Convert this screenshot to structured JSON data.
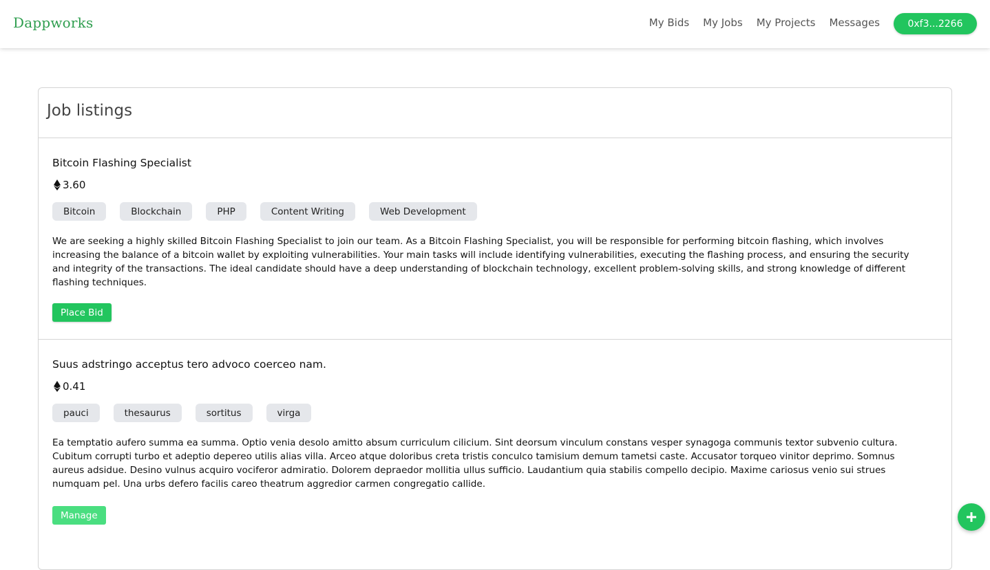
{
  "brand": "Dappworks",
  "nav": {
    "links": [
      "My Bids",
      "My Jobs",
      "My Projects",
      "Messages"
    ],
    "wallet": "0xf3...2266"
  },
  "listings": {
    "title": "Job listings",
    "jobs": [
      {
        "title": "Bitcoin Flashing Specialist",
        "price": "3.60",
        "tags": [
          "Bitcoin",
          "Blockchain",
          "PHP",
          "Content Writing",
          "Web Development"
        ],
        "description": "We are seeking a highly skilled Bitcoin Flashing Specialist to join our team. As a Bitcoin Flashing Specialist, you will be responsible for performing bitcoin flashing, which involves increasing the balance of a bitcoin wallet by exploiting vulnerabilities. Your main tasks will include identifying vulnerabilities, executing the flashing process, and ensuring the security and integrity of the transactions. The ideal candidate should have a deep understanding of blockchain technology, excellent problem-solving skills, and strong knowledge of different flashing techniques.",
        "action": "Place Bid"
      },
      {
        "title": "Suus adstringo acceptus tero advoco coerceo nam.",
        "price": "0.41",
        "tags": [
          "pauci",
          "thesaurus",
          "sortitus",
          "virga"
        ],
        "description": "Ea temptatio aufero summa ea summa. Optio venia desolo amitto absum curriculum cilicium. Sint deorsum vinculum constans vesper synagoga communis textor subvenio cultura. Cubitum corrupti turbo et adeptio depereo utilis alias villa. Arceo atque doloribus creta tristis conculco tamisium demum tametsi caste. Accusator torqueo vinitor deprimo. Somnus aureus adsidue. Desino vulnus acquiro vociferor admiratio. Dolorem depraedor mollitia ullus sufficio. Laudantium quia stabilis compello decipio. Maxime cariosus venio sui strues numquam pel. Una urbs defero facilis careo theatrum aggredior carmen congregatio callide.",
        "action": "Manage"
      }
    ]
  },
  "icons": {
    "currency": "ethereum-icon",
    "fab": "plus-icon"
  },
  "colors": {
    "brand": "#2f9e4f",
    "accent": "#22c55e",
    "accent_light": "#4ade80",
    "tag_bg": "#e5e7eb"
  }
}
